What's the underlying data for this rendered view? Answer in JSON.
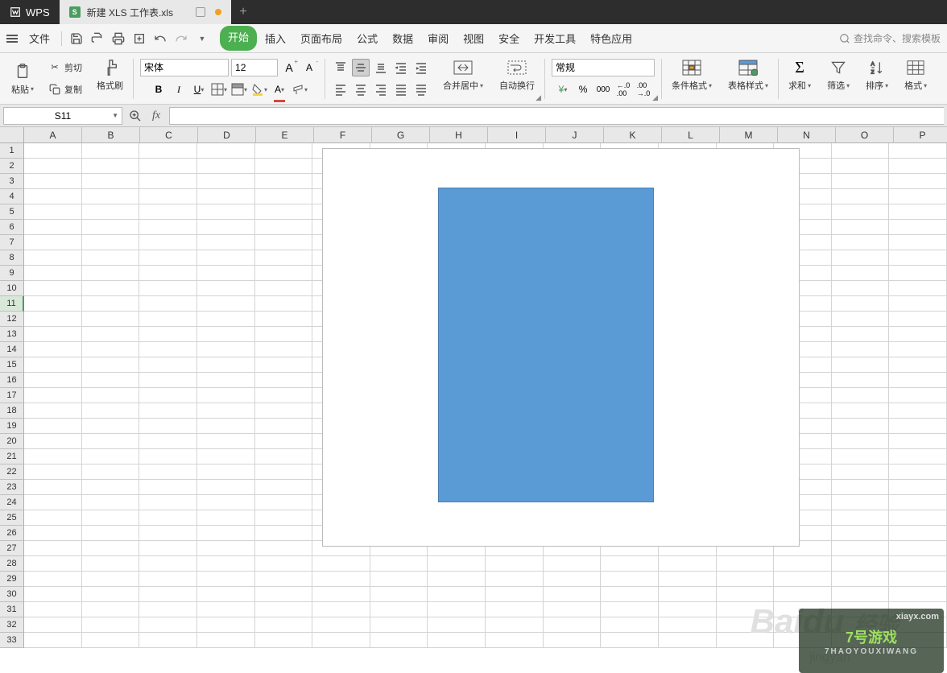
{
  "title_bar": {
    "app_name": "WPS",
    "tab_title": "新建 XLS 工作表.xls"
  },
  "menu": {
    "file": "文件",
    "items": [
      "开始",
      "插入",
      "页面布局",
      "公式",
      "数据",
      "审阅",
      "视图",
      "安全",
      "开发工具",
      "特色应用"
    ],
    "active_index": 0,
    "search_placeholder": "查找命令、搜索模板"
  },
  "ribbon": {
    "paste": "粘贴",
    "cut": "剪切",
    "copy": "复制",
    "format_painter": "格式刷",
    "font_name": "宋体",
    "font_size": "12",
    "merge_center": "合并居中",
    "wrap_text": "自动换行",
    "number_format": "常规",
    "cond_format": "条件格式",
    "table_style": "表格样式",
    "sum": "求和",
    "filter": "筛选",
    "sort": "排序",
    "format": "格式"
  },
  "formula_bar": {
    "cell_ref": "S11"
  },
  "grid": {
    "columns": [
      "A",
      "B",
      "C",
      "D",
      "E",
      "F",
      "G",
      "H",
      "I",
      "J",
      "K",
      "L",
      "M",
      "N",
      "O",
      "P"
    ],
    "row_count": 33,
    "active_row": 11
  },
  "watermark": {
    "brand": "Baidu",
    "sub": "jingyan",
    "url": "xiayx.com",
    "game": "7号游戏",
    "game_sub": "7HAOYOUXIWANG"
  }
}
